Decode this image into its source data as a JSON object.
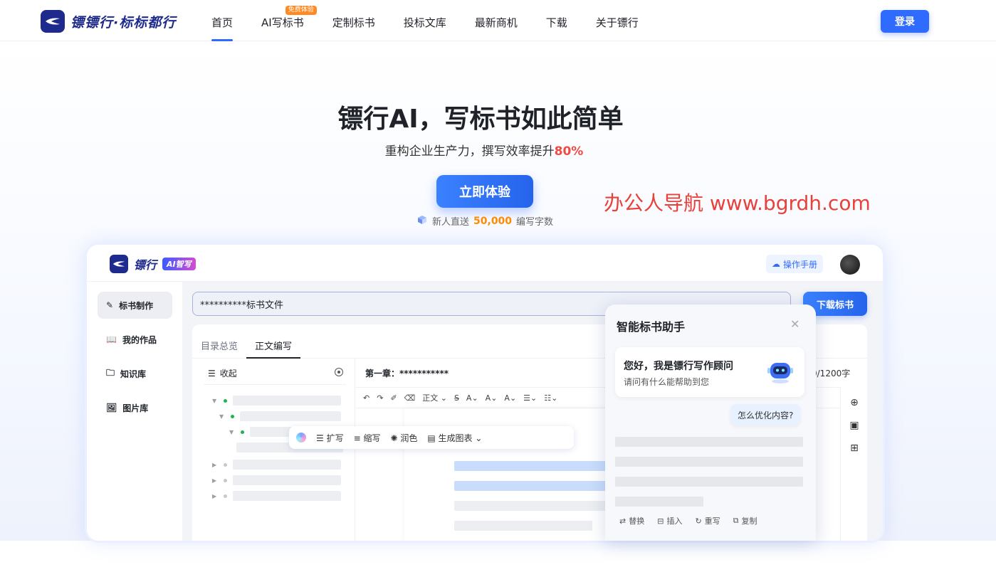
{
  "brand": {
    "name": "镖镖行·标标都行"
  },
  "nav": {
    "items": [
      {
        "label": "首页",
        "active": true
      },
      {
        "label": "AI写标书",
        "badge": "免费体验"
      },
      {
        "label": "定制标书"
      },
      {
        "label": "投标文库"
      },
      {
        "label": "最新商机"
      },
      {
        "label": "下载"
      },
      {
        "label": "关于镖行"
      }
    ],
    "login": "登录"
  },
  "hero": {
    "title": "镖行AI，写标书如此简单",
    "subtitle_prefix": "重构企业生产力，撰写效率提升",
    "subtitle_highlight": "80%",
    "cta": "立即体验",
    "gift_prefix": "新人直送",
    "gift_amount": "50,000",
    "gift_suffix": "编写字数"
  },
  "watermark": "办公人导航  www.bgrdh.com",
  "app": {
    "name": "镖行",
    "ai_tag": "AI智写",
    "manual": "操作手册",
    "sidebar": [
      {
        "label": "标书制作",
        "icon": "pen-icon",
        "active": true
      },
      {
        "label": "我的作品",
        "icon": "book-icon"
      },
      {
        "label": "知识库",
        "icon": "folder-icon"
      },
      {
        "label": "图片库",
        "icon": "image-icon"
      }
    ],
    "file_name": "**********标书文件",
    "download": "下载标书",
    "tabs": [
      "目录总览",
      "正文编写"
    ],
    "toc_collapse": "收起",
    "chapter": "第一章：***********",
    "word_count": "0/1200字",
    "toolbar": [
      "正文",
      "A",
      "A",
      "A"
    ],
    "float_actions": [
      "扩写",
      "缩写",
      "润色",
      "生成图表"
    ]
  },
  "assistant": {
    "title": "智能标书助手",
    "greeting": "您好，我是镖行写作顾问",
    "ask": "请问有什么能帮助到您",
    "question": "怎么优化内容?",
    "actions": [
      "替换",
      "插入",
      "重写",
      "复制"
    ]
  },
  "colors": {
    "accent": "#2f6bff",
    "highlight": "#f04a42",
    "orange": "#ff8a00",
    "navy": "#1e2a8c"
  }
}
